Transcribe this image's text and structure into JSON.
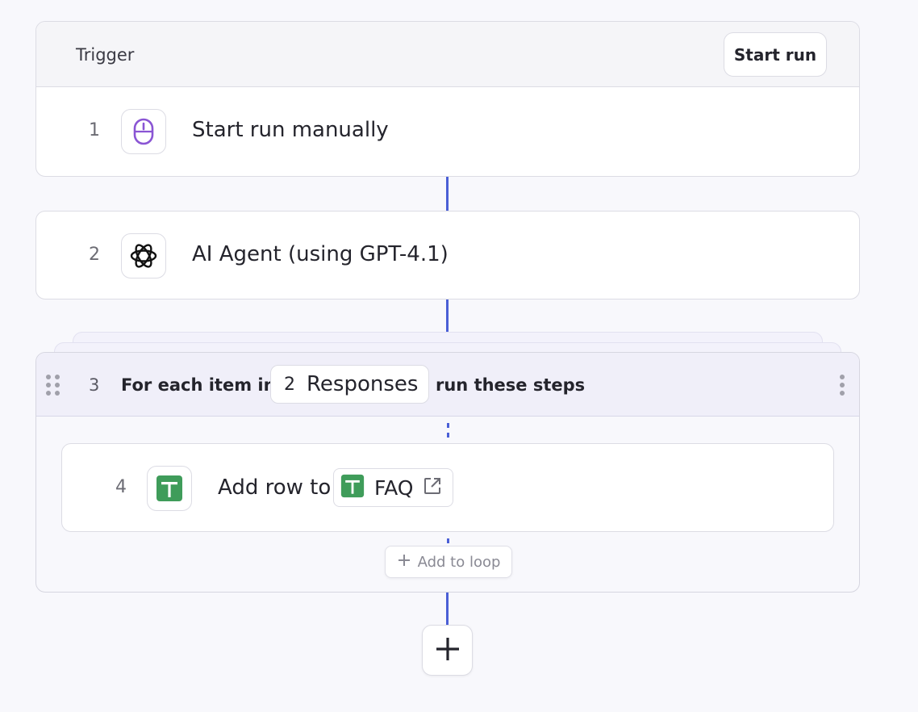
{
  "trigger": {
    "label": "Trigger",
    "start_run_label": "Start run"
  },
  "steps": [
    {
      "number": "1",
      "title": "Start run manually",
      "icon": "mouse-icon"
    },
    {
      "number": "2",
      "title": "AI Agent (using GPT-4.1)",
      "icon": "openai-icon"
    }
  ],
  "loop": {
    "number": "3",
    "prefix": "For each item  in",
    "variable_count": "2",
    "variable_name": "Responses",
    "suffix": "run these steps",
    "inner_step": {
      "number": "4",
      "title": "Add row to",
      "icon": "google-sheets-icon",
      "target_name": "FAQ",
      "target_icon": "external-link-icon"
    },
    "add_to_loop_label": "Add to loop"
  },
  "add_step_icon": "plus-icon",
  "colors": {
    "connector": "#4a5fd6",
    "mouse_icon": "#8a55d4",
    "sheets_green": "#3f9c5a",
    "loop_header_bg": "#f0eff9"
  }
}
